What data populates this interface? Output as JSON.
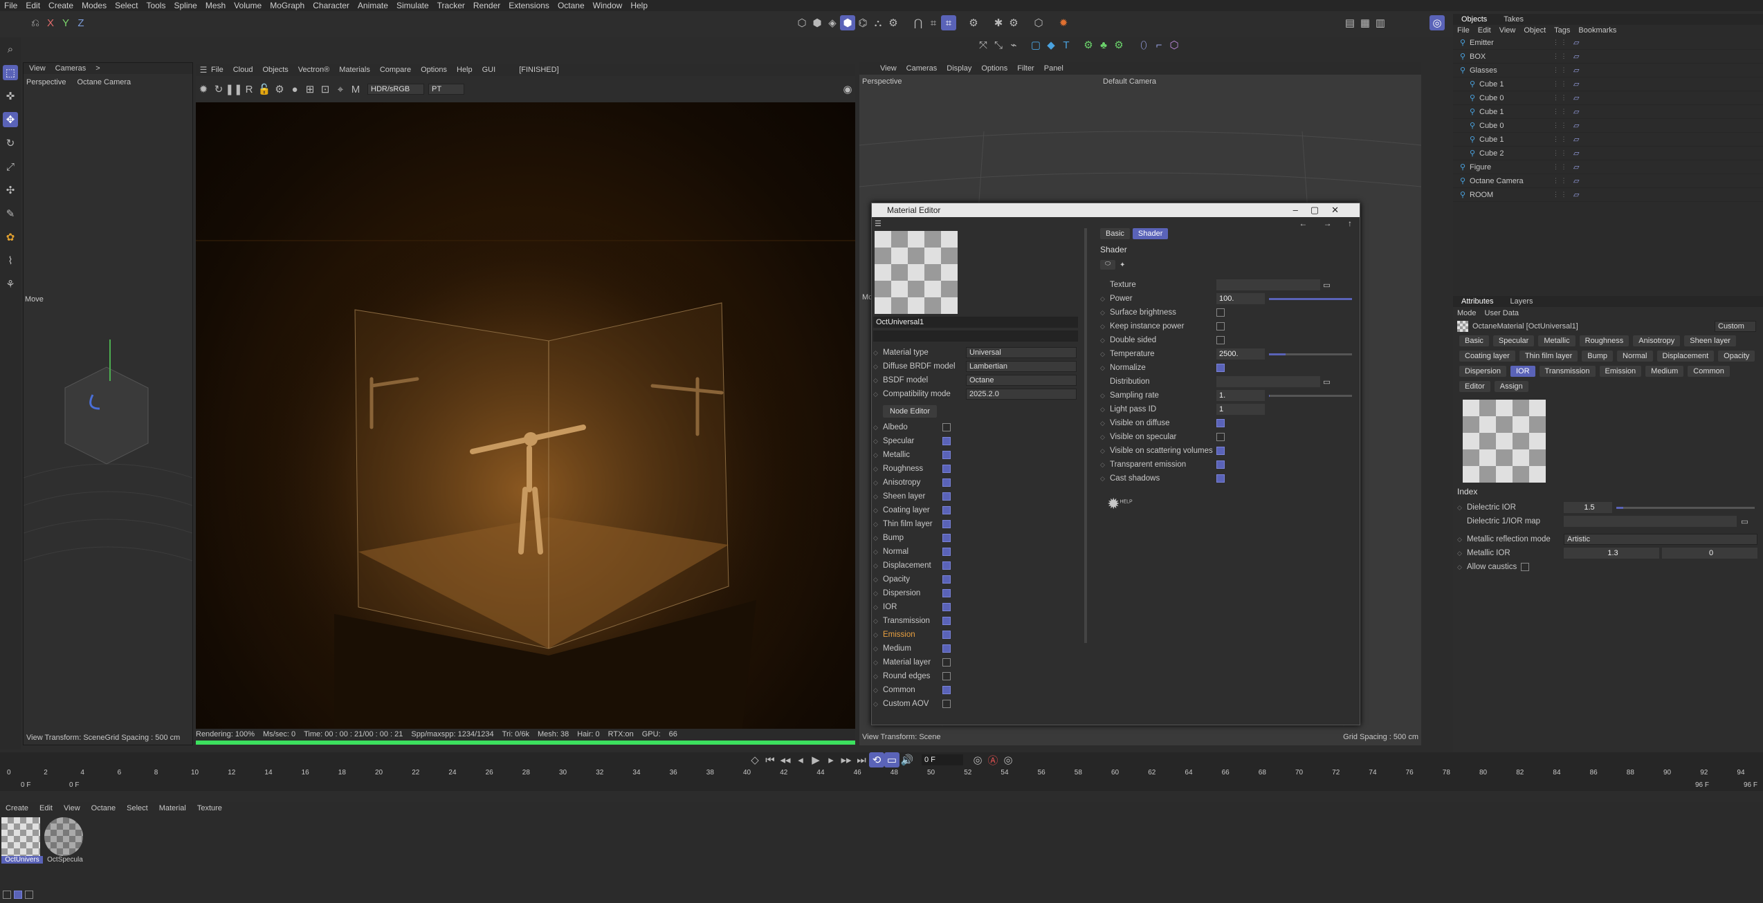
{
  "menubar": [
    "File",
    "Edit",
    "Create",
    "Modes",
    "Select",
    "Tools",
    "Spline",
    "Mesh",
    "Volume",
    "MoGraph",
    "Character",
    "Animate",
    "Simulate",
    "Tracker",
    "Render",
    "Extensions",
    "Octane",
    "Window",
    "Help"
  ],
  "axes": [
    "X",
    "Y",
    "Z"
  ],
  "left_viewport": {
    "menu": [
      "View",
      "Cameras",
      ">"
    ],
    "label": "Perspective",
    "camera": "Octane Camera",
    "tool": "Move",
    "status": "View Transform: Scene",
    "grid": "Grid Spacing : 500 cm"
  },
  "render_view": {
    "menu": [
      "File",
      "Cloud",
      "Objects",
      "Vectron®",
      "Materials",
      "Compare",
      "Options",
      "Help",
      "GUI"
    ],
    "state": "[FINISHED]",
    "color_mode": "HDR/sRGB",
    "kernel": "PT",
    "status": [
      "Rendering: 100%",
      "Ms/sec: 0",
      "Time: 00 : 00 : 21/00 : 00 : 21",
      "Spp/maxspp: 1234/1234",
      "Tri: 0/6k",
      "Mesh: 38",
      "Hair: 0",
      "RTX:on",
      "GPU:",
      "66"
    ],
    "progress": 1.0
  },
  "right_viewport": {
    "menu": [
      "View",
      "Cameras",
      "Display",
      "Options",
      "Filter",
      "Panel"
    ],
    "label": "Perspective",
    "camera": "Default Camera",
    "status": "View Transform: Scene",
    "grid": "Grid Spacing : 500 cm",
    "prefix": "Mc"
  },
  "material_editor": {
    "title": "Material Editor",
    "mat_name": "OctUniversal1",
    "settings": [
      {
        "label": "Material type",
        "value": "Universal"
      },
      {
        "label": "Diffuse BRDF model",
        "value": "Lambertian"
      },
      {
        "label": "BSDF model",
        "value": "Octane"
      },
      {
        "label": "Compatibility mode",
        "value": "2025.2.0"
      }
    ],
    "node_editor": "Node Editor",
    "channels": [
      {
        "label": "Albedo",
        "on": false
      },
      {
        "label": "Specular",
        "on": true
      },
      {
        "label": "Metallic",
        "on": true
      },
      {
        "label": "Roughness",
        "on": true
      },
      {
        "label": "Anisotropy",
        "on": true
      },
      {
        "label": "Sheen layer",
        "on": true
      },
      {
        "label": "Coating layer",
        "on": true
      },
      {
        "label": "Thin film layer",
        "on": true
      },
      {
        "label": "Bump",
        "on": true
      },
      {
        "label": "Normal",
        "on": true
      },
      {
        "label": "Displacement",
        "on": true
      },
      {
        "label": "Opacity",
        "on": true
      },
      {
        "label": "Dispersion",
        "on": true
      },
      {
        "label": "IOR",
        "on": true
      },
      {
        "label": "Transmission",
        "on": true
      },
      {
        "label": "Emission",
        "on": true,
        "highlight": true
      },
      {
        "label": "Medium",
        "on": true
      },
      {
        "label": "Material layer",
        "on": false
      },
      {
        "label": "Round edges",
        "on": false
      },
      {
        "label": "Common",
        "on": true
      },
      {
        "label": "Custom AOV",
        "on": false
      }
    ],
    "tabs": [
      "Basic",
      "Shader"
    ],
    "active_tab": "Shader",
    "section": "Shader",
    "shader_params": [
      {
        "label": "Texture",
        "type": "texture"
      },
      {
        "label": "Power",
        "type": "slider",
        "value": "100.",
        "fill": 1.0
      },
      {
        "label": "Surface brightness",
        "type": "check",
        "on": false
      },
      {
        "label": "Keep instance power",
        "type": "check",
        "on": false
      },
      {
        "label": "Double sided",
        "type": "check",
        "on": false
      },
      {
        "label": "Temperature",
        "type": "slider",
        "value": "2500.",
        "fill": 0.2
      },
      {
        "label": "Normalize",
        "type": "check",
        "on": true
      },
      {
        "label": "Distribution",
        "type": "texture"
      },
      {
        "label": "Sampling rate",
        "type": "slider",
        "value": "1.",
        "fill": 0.01
      },
      {
        "label": "Light pass ID",
        "type": "num",
        "value": "1"
      },
      {
        "label": "Visible on diffuse",
        "type": "check",
        "on": true
      },
      {
        "label": "Visible on specular",
        "type": "check",
        "on": false
      },
      {
        "label": "Visible on scattering volumes",
        "type": "check",
        "on": true
      },
      {
        "label": "Transparent emission",
        "type": "check",
        "on": true
      },
      {
        "label": "Cast shadows",
        "type": "check",
        "on": true
      }
    ],
    "help": "HELP"
  },
  "objects_panel": {
    "tabs": [
      "Objects",
      "Takes"
    ],
    "menu": [
      "File",
      "Edit",
      "View",
      "Object",
      "Tags",
      "Bookmarks"
    ],
    "items": [
      {
        "name": "Emitter",
        "indent": 0
      },
      {
        "name": "BOX",
        "indent": 0
      },
      {
        "name": "Glasses",
        "indent": 0
      },
      {
        "name": "Cube 1",
        "indent": 1
      },
      {
        "name": "Cube 0",
        "indent": 1
      },
      {
        "name": "Cube 1",
        "indent": 1
      },
      {
        "name": "Cube 0",
        "indent": 1
      },
      {
        "name": "Cube 1",
        "indent": 1
      },
      {
        "name": "Cube 2",
        "indent": 1
      },
      {
        "name": "Figure",
        "indent": 0
      },
      {
        "name": "Octane Camera",
        "indent": 0
      },
      {
        "name": "ROOM",
        "indent": 0
      }
    ]
  },
  "attributes_panel": {
    "tabs": [
      "Attributes",
      "Layers"
    ],
    "menu": [
      "Mode",
      "User Data"
    ],
    "title": "OctaneMaterial [OctUniversal1]",
    "preset": "Custom",
    "chips": [
      "Basic",
      "Specular",
      "Metallic",
      "Roughness",
      "Anisotropy",
      "Sheen layer",
      "Coating layer",
      "Thin film layer",
      "Bump",
      "Normal",
      "Displacement",
      "Opacity",
      "Dispersion",
      "IOR",
      "Transmission",
      "Emission",
      "Medium",
      "Common",
      "Editor",
      "Assign"
    ],
    "active_chip": "IOR",
    "section": "Index",
    "dielectric_ior_label": "Dielectric IOR",
    "dielectric_ior": "1.5",
    "dielectric_map_label": "Dielectric 1/IOR map",
    "metallic_mode_label": "Metallic reflection mode",
    "metallic_mode": "Artistic",
    "metallic_ior_label": "Metallic IOR",
    "metallic_ior": [
      "1.3",
      "0"
    ],
    "caustics_label": "Allow caustics"
  },
  "timeline": {
    "ticks": [
      "0",
      "2",
      "4",
      "6",
      "8",
      "10",
      "12",
      "14",
      "16",
      "18",
      "20",
      "22",
      "24",
      "26",
      "28",
      "30",
      "32",
      "34",
      "36",
      "38",
      "40",
      "42",
      "44",
      "46",
      "48",
      "50",
      "52",
      "54",
      "56",
      "58",
      "60",
      "62",
      "64",
      "66",
      "68",
      "70",
      "72",
      "74",
      "76",
      "78",
      "80",
      "82",
      "84",
      "86",
      "88",
      "90",
      "92",
      "94"
    ],
    "current": "0 F",
    "start": "0 F",
    "start2": "0 F",
    "end": "96 F",
    "end2": "96 F"
  },
  "material_manager": {
    "menu": [
      "Create",
      "Edit",
      "View",
      "Octane",
      "Select",
      "Material",
      "Texture"
    ],
    "materials": [
      "OctUnivers",
      "OctSpecula"
    ]
  }
}
